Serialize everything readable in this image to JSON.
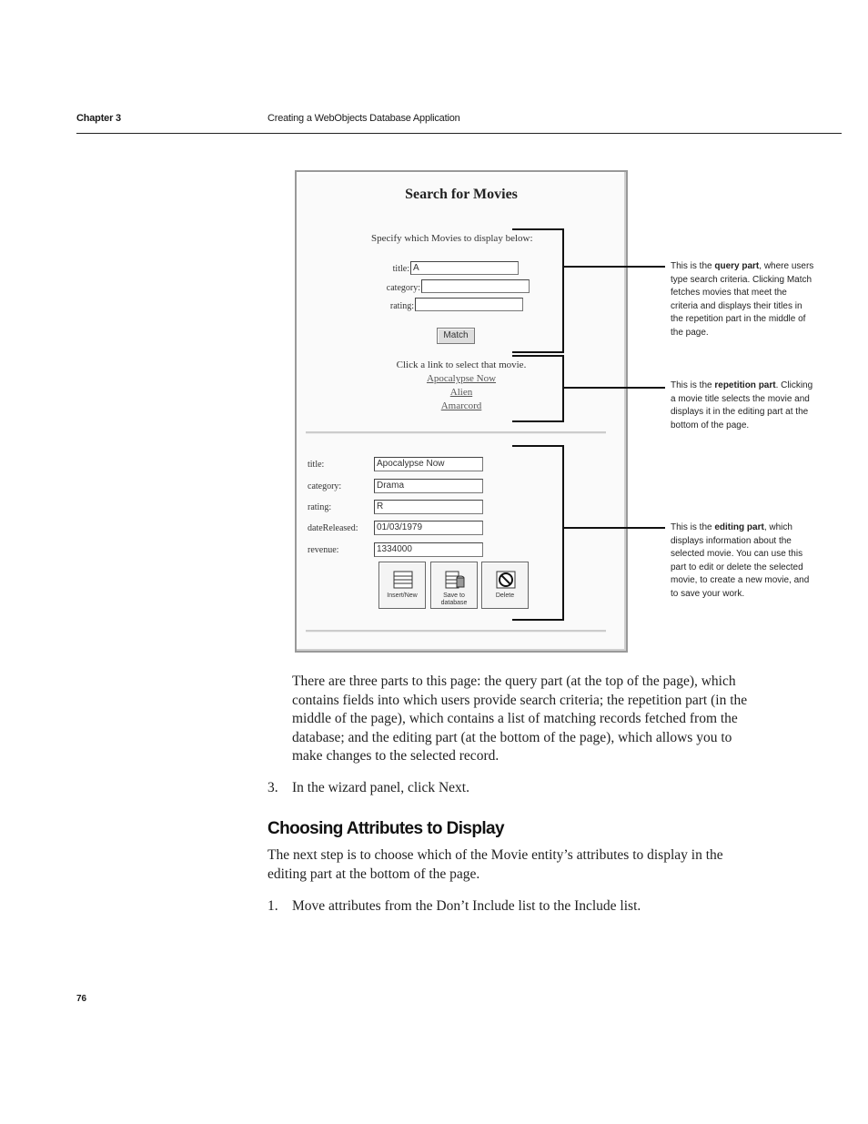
{
  "header": {
    "chapter": "Chapter 3",
    "title": "Creating a WebObjects Database Application"
  },
  "figure": {
    "title": "Search for Movies",
    "query": {
      "prompt": "Specify which Movies to display below:",
      "fields": [
        {
          "label": "title:",
          "value": "A"
        },
        {
          "label": "category:",
          "value": ""
        },
        {
          "label": "rating:",
          "value": ""
        }
      ],
      "match_label": "Match"
    },
    "repetition": {
      "prompt": "Click a link to select that movie.",
      "movies": [
        "Apocalypse Now",
        "Alien",
        "Amarcord"
      ]
    },
    "editing": {
      "fields": [
        {
          "label": "title:",
          "value": "Apocalypse Now"
        },
        {
          "label": "category:",
          "value": "Drama"
        },
        {
          "label": "rating:",
          "value": "R"
        },
        {
          "label": "dateReleased:",
          "value": "01/03/1979"
        },
        {
          "label": "revenue:",
          "value": "1334000"
        }
      ],
      "buttons": [
        {
          "label": "Insert/New",
          "icon": "insert-new-icon"
        },
        {
          "label": "Save to database",
          "icon": "save-to-database-icon"
        },
        {
          "label": "Delete",
          "icon": "delete-icon"
        }
      ]
    }
  },
  "callouts": {
    "query": {
      "pre": "This is the ",
      "bold": "query part",
      "post": ", where users type search criteria. Clicking Match fetches movies that meet the criteria and displays their titles in the repetition part in the middle of the page."
    },
    "repetition": {
      "pre": "This is the ",
      "bold": "repetition part",
      "post": ". Clicking a movie title selects the movie and displays it in the editing part at the bottom of the page."
    },
    "editing": {
      "pre": "This is the ",
      "bold": "editing part",
      "post": ", which displays information about the selected movie. You can use this part to edit or delete the selected movie, to create a new movie, and to save your work."
    }
  },
  "body": {
    "paragraph1": "There are three parts to this page: the query part (at the top of the page), which contains fields into which users provide search criteria; the repetition part (in the middle of the page), which contains a list of matching records fetched from the database; and the editing part (at the bottom of the page), which allows you to make changes to the selected record.",
    "step3_num": "3.",
    "step3_text": "In the wizard panel, click Next.",
    "section_heading": "Choosing Attributes to Display",
    "paragraph2": "The next step is to choose which of the Movie entity’s attributes to display in the editing part at the bottom of the page.",
    "step1_num": "1.",
    "step1_text": "Move attributes from the Don’t Include list to the Include list."
  },
  "page_number": "76"
}
